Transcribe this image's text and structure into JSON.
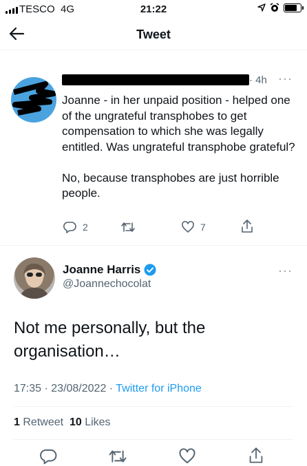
{
  "status_bar": {
    "carrier": "TESCO",
    "network": "4G",
    "time": "21:22"
  },
  "header": {
    "title": "Tweet"
  },
  "parent_tweet": {
    "time_ago": "4h",
    "text": "Joanne - in her unpaid position - helped one of the ungrateful transphobes to get compensation to which she was legally entitled. Was ungrateful transphobe grateful?\n\nNo, because transphobes are just horrible people.",
    "replies": "2",
    "likes": "7"
  },
  "main_tweet": {
    "display_name": "Joanne Harris",
    "handle": "@Joannechocolat",
    "text": "Not me personally, but the organisation…",
    "time": "17:35",
    "date": "23/08/2022",
    "source": "Twitter for iPhone",
    "retweet_count": "1",
    "retweet_label": "Retweet",
    "like_count": "10",
    "like_label": "Likes"
  },
  "colors": {
    "accent": "#1d9bf0",
    "muted": "#536471",
    "text": "#0f1419"
  },
  "icons": [
    "back-arrow-icon",
    "reply-icon",
    "retweet-icon",
    "like-icon",
    "share-icon",
    "verified-icon",
    "more-icon",
    "location-arrow-icon",
    "alarm-icon",
    "battery-icon"
  ]
}
